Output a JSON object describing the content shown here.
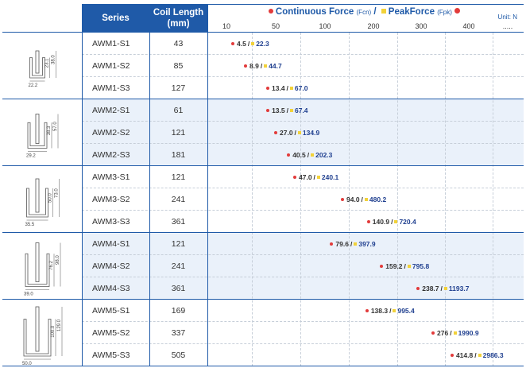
{
  "header": {
    "series_label": "Series",
    "coil_label_1": "Coil Length",
    "coil_label_2": "(mm)",
    "continuous_label": "Continuous Force",
    "continuous_sub": "(Fcn)",
    "separator": "/",
    "peak_label": "PeakForce",
    "peak_sub": "(Fpk)",
    "unit": "Unit: N"
  },
  "colors": {
    "header_blue": "#1f5aa8",
    "continuous_dot": "#e23b3b",
    "peak_square": "#f2d23a",
    "band_light": "#eaf1fa"
  },
  "chart_data": {
    "type": "scatter",
    "title": "",
    "x_ticks": [
      "10",
      "50",
      "100",
      "200",
      "300",
      "400",
      "....."
    ],
    "series_names": [
      "Continuous Force",
      "PeakForce"
    ],
    "rows": [
      {
        "series": "AWM1-S1",
        "coil_length": "43",
        "continuous": "4.5",
        "peak": "22.3"
      },
      {
        "series": "AWM1-S2",
        "coil_length": "85",
        "continuous": "8.9",
        "peak": "44.7"
      },
      {
        "series": "AWM1-S3",
        "coil_length": "127",
        "continuous": "13.4",
        "peak": "67.0"
      },
      {
        "series": "AWM2-S1",
        "coil_length": "61",
        "continuous": "13.5",
        "peak": "67.4"
      },
      {
        "series": "AWM2-S2",
        "coil_length": "121",
        "continuous": "27.0",
        "peak": "134.9"
      },
      {
        "series": "AWM2-S3",
        "coil_length": "181",
        "continuous": "40.5",
        "peak": "202.3"
      },
      {
        "series": "AWM3-S1",
        "coil_length": "121",
        "continuous": "47.0",
        "peak": "240.1"
      },
      {
        "series": "AWM3-S2",
        "coil_length": "241",
        "continuous": "94.0",
        "peak": "480.2"
      },
      {
        "series": "AWM3-S3",
        "coil_length": "361",
        "continuous": "140.9",
        "peak": "720.4"
      },
      {
        "series": "AWM4-S1",
        "coil_length": "121",
        "continuous": "79.6",
        "peak": "397.9"
      },
      {
        "series": "AWM4-S2",
        "coil_length": "241",
        "continuous": "159.2",
        "peak": "795.8"
      },
      {
        "series": "AWM4-S3",
        "coil_length": "361",
        "continuous": "238.7",
        "peak": "1193.7"
      },
      {
        "series": "AWM5-S1",
        "coil_length": "169",
        "continuous": "138.3",
        "peak": "995.4"
      },
      {
        "series": "AWM5-S2",
        "coil_length": "337",
        "continuous": "276",
        "peak": "1990.9"
      },
      {
        "series": "AWM5-S3",
        "coil_length": "505",
        "continuous": "414.8",
        "peak": "2986.3"
      }
    ],
    "groups": [
      {
        "name": "AWM1",
        "width_label": "22.2",
        "height_labels": [
          "23.1",
          "38.0"
        ]
      },
      {
        "name": "AWM2",
        "width_label": "29.2",
        "height_labels": [
          "38.3",
          "57.0"
        ]
      },
      {
        "name": "AWM3",
        "width_label": "35.5",
        "height_labels": [
          "50.0",
          "73.0"
        ]
      },
      {
        "name": "AWM4",
        "width_label": "39.0",
        "height_labels": [
          "76.2",
          "98.0"
        ]
      },
      {
        "name": "AWM5",
        "width_label": "50.0",
        "height_labels": [
          "100.0",
          "129.0"
        ]
      }
    ]
  }
}
